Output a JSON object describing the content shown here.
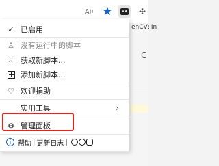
{
  "toolbar": {
    "read_aloud_icon": "read-aloud-icon",
    "favorite_icon": "star-icon",
    "extension_icon": "tampermonkey-icon",
    "more_icon": "puzzle-icon"
  },
  "page": {
    "snippet": "enCV: In",
    "glyph": "C"
  },
  "menu": {
    "items": [
      {
        "icon": "✓",
        "label": "已启用"
      },
      {
        "icon": "♙",
        "label": "没有运行中的脚本"
      },
      {
        "icon": "⌕",
        "label": "获取新脚本..."
      },
      {
        "icon": "add-box",
        "label": "添加新脚本..."
      },
      {
        "icon": "♡",
        "label": "欢迎捐助"
      },
      {
        "icon": "",
        "label": "实用工具",
        "chevron": "›"
      },
      {
        "icon": "⚙",
        "label": "管理面板"
      }
    ],
    "footer": {
      "help": "帮助",
      "sep": "|",
      "changelog": "更新日志",
      "sep2": "|"
    }
  },
  "colors": {
    "accent": "#1565c0",
    "highlight": "#d6291f",
    "heart": "#d9443f"
  }
}
